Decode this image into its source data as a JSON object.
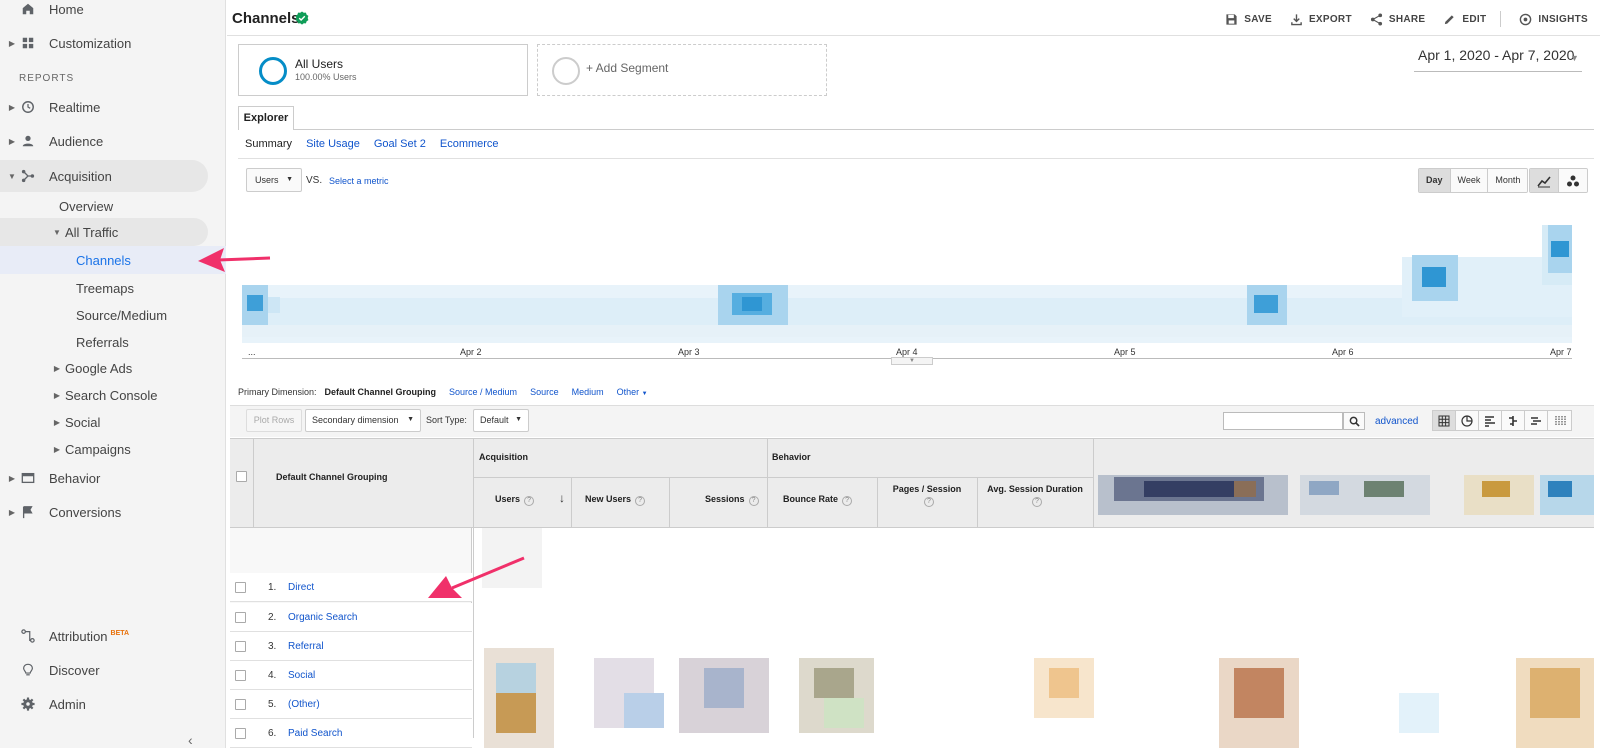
{
  "sidebar": {
    "home": "Home",
    "customization": "Customization",
    "reports_label": "REPORTS",
    "realtime": "Realtime",
    "audience": "Audience",
    "acquisition": "Acquisition",
    "overview": "Overview",
    "all_traffic": "All Traffic",
    "channels": "Channels",
    "treemaps": "Treemaps",
    "source_medium": "Source/Medium",
    "referrals": "Referrals",
    "google_ads": "Google Ads",
    "search_console": "Search Console",
    "social": "Social",
    "campaigns": "Campaigns",
    "behavior": "Behavior",
    "conversions": "Conversions",
    "attribution": "Attribution",
    "attribution_badge": "BETA",
    "discover": "Discover",
    "admin": "Admin"
  },
  "header": {
    "title": "Channels",
    "actions": {
      "save": "SAVE",
      "export": "EXPORT",
      "share": "SHARE",
      "edit": "EDIT",
      "insights": "INSIGHTS"
    }
  },
  "segments": {
    "primary_title": "All Users",
    "primary_sub": "100.00% Users",
    "add": "+ Add Segment"
  },
  "date_range": "Apr 1, 2020 - Apr 7, 2020",
  "explorer": {
    "tab": "Explorer",
    "subtabs": [
      "Summary",
      "Site Usage",
      "Goal Set 2",
      "Ecommerce"
    ]
  },
  "metric": {
    "selected": "Users",
    "vs": "VS.",
    "select_metric": "Select a metric",
    "granularity": [
      "Day",
      "Week",
      "Month"
    ],
    "granularity_active": "Day"
  },
  "chart_data": {
    "type": "line",
    "x_ticks": [
      "...",
      "Apr 2",
      "Apr 3",
      "Apr 4",
      "Apr 5",
      "Apr 6",
      "Apr 7"
    ]
  },
  "primary_dimension": {
    "label": "Primary Dimension:",
    "options": [
      "Default Channel Grouping",
      "Source / Medium",
      "Source",
      "Medium",
      "Other"
    ]
  },
  "table_toolbar": {
    "plot_rows": "Plot Rows",
    "secondary_dimension": "Secondary dimension",
    "sort_type_label": "Sort Type:",
    "sort_type": "Default",
    "advanced": "advanced"
  },
  "table": {
    "dimension_header": "Default Channel Grouping",
    "group_acquisition": "Acquisition",
    "group_behavior": "Behavior",
    "columns": {
      "users": "Users",
      "new_users": "New Users",
      "sessions": "Sessions",
      "bounce_rate": "Bounce Rate",
      "pages_session": "Pages / Session",
      "avg_session": "Avg. Session Duration"
    },
    "rows": [
      {
        "num": "1.",
        "name": "Direct"
      },
      {
        "num": "2.",
        "name": "Organic Search"
      },
      {
        "num": "3.",
        "name": "Referral"
      },
      {
        "num": "4.",
        "name": "Social"
      },
      {
        "num": "5.",
        "name": "(Other)"
      },
      {
        "num": "6.",
        "name": "Paid Search"
      }
    ]
  }
}
